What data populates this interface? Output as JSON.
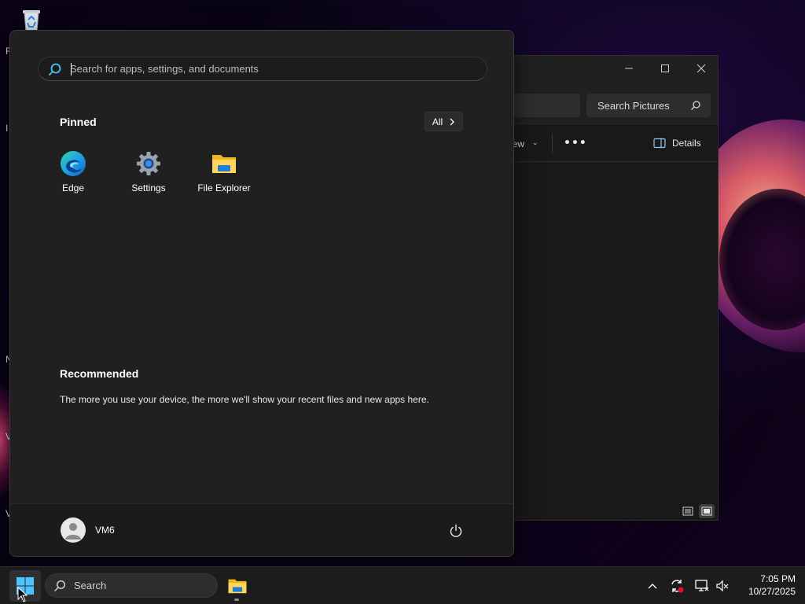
{
  "desktop": {
    "icons": [
      {
        "name": "recycle-bin-icon"
      }
    ],
    "edge_letters": [
      "F",
      "I",
      "N",
      "V",
      "V"
    ]
  },
  "explorer": {
    "search_placeholder": "Search Pictures",
    "view_label": "iew",
    "details_label": "Details",
    "more_label": "•••"
  },
  "start_menu": {
    "search": {
      "placeholder": "Search for apps, settings, and documents",
      "value": ""
    },
    "pinned": {
      "title": "Pinned",
      "all_label": "All",
      "apps": [
        {
          "label": "Edge",
          "icon": "edge-icon"
        },
        {
          "label": "Settings",
          "icon": "settings-icon"
        },
        {
          "label": "File Explorer",
          "icon": "file-explorer-icon"
        }
      ]
    },
    "recommended": {
      "title": "Recommended",
      "text": "The more you use your device, the more we'll show your recent files and new apps here."
    },
    "user": {
      "name": "VM6"
    }
  },
  "taskbar": {
    "search_label": "Search",
    "clock": {
      "time": "7:05 PM",
      "date": "10/27/2025"
    }
  },
  "colors": {
    "accent_blue": "#4cc2ff",
    "start_bg": "#202020",
    "taskbar_bg": "#1c1c1c",
    "folder_yellow": "#ffc83d"
  }
}
